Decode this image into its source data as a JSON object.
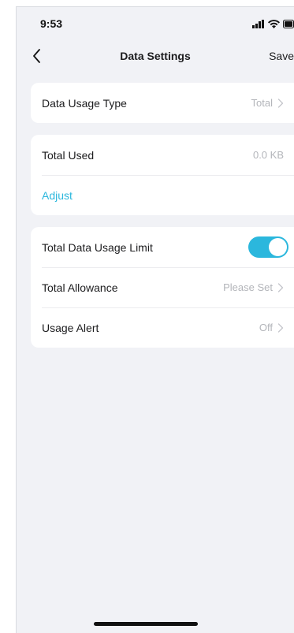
{
  "status_bar": {
    "time": "9:53",
    "icons": [
      "signal-icon",
      "wifi-icon",
      "battery-icon"
    ]
  },
  "nav": {
    "back_icon": "chevron-left-icon",
    "title": "Data Settings",
    "save_label": "Save"
  },
  "usage_type_card": {
    "label": "Data Usage Type",
    "value": "Total"
  },
  "used_card": {
    "total_used_label": "Total Used",
    "total_used_value": "0.0 KB",
    "adjust_label": "Adjust"
  },
  "limit_card": {
    "limit_label": "Total Data Usage Limit",
    "limit_enabled": true,
    "allowance_label": "Total Allowance",
    "allowance_value": "Please Set",
    "alert_label": "Usage Alert",
    "alert_value": "Off"
  },
  "colors": {
    "accent": "#2bb7dd",
    "background": "#f1f2f6",
    "card": "#ffffff",
    "secondary_text": "#b3b5ba"
  }
}
